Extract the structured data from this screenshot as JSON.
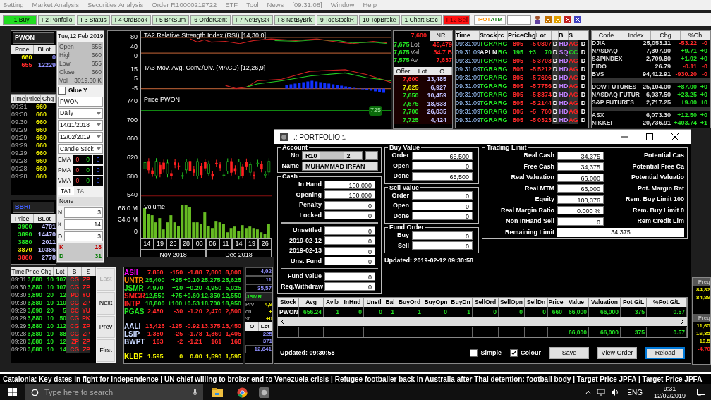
{
  "menu": [
    "Setting",
    "Market Analysis",
    "Securities Analysis",
    "Order R10000219722",
    "ETF",
    "Tool",
    "News",
    "[09:31:08]",
    "Window",
    "Help"
  ],
  "toolbar": [
    {
      "label": "F1 Buy",
      "kind": "buy"
    },
    {
      "label": "F2 Portfolio",
      "kind": "plain"
    },
    {
      "label": "F3 Status",
      "kind": "plain"
    },
    {
      "label": "F4 OrdBook",
      "kind": "plain"
    },
    {
      "label": "F5 BrkSum",
      "kind": "plain"
    },
    {
      "label": "6 OrderCent",
      "kind": "plain"
    },
    {
      "label": "F7 NetByStk",
      "kind": "plain"
    },
    {
      "label": "F8 NetByBrk",
      "kind": "plain"
    },
    {
      "label": "9 TopStockR",
      "kind": "plain"
    },
    {
      "label": "10 TopBroke",
      "kind": "plain"
    },
    {
      "label": "1 Chart Stoc",
      "kind": "plain"
    },
    {
      "label": "F12 Sell",
      "kind": "sell"
    }
  ],
  "logo": {
    "left": "IPOT",
    "right": "ATM"
  },
  "top_book": {
    "code": "PWON",
    "columns": [
      "Price",
      "BLot"
    ],
    "rows": [
      {
        "price": "660",
        "lot": "0",
        "up": false,
        "down": false
      },
      {
        "price": "655",
        "lot": "12229",
        "up": false,
        "down": true
      }
    ]
  },
  "chart_panel": {
    "date": "Tue,12 Feb 2019",
    "ohlc": [
      {
        "label": "Open",
        "value": "655"
      },
      {
        "label": "High",
        "value": "660"
      },
      {
        "label": "Low",
        "value": "655"
      },
      {
        "label": "Close",
        "value": "660"
      },
      {
        "label": "Vol",
        "value": "3019.60 K"
      }
    ],
    "glue_y": {
      "label": "Glue Y",
      "checked": false
    },
    "code": "PWON",
    "period": "Daily",
    "from": "14/11/2018",
    "to": "12/02/2019",
    "style": "Candle Stick",
    "averages": [
      {
        "label": "EMA",
        "values": [
          "0",
          "0",
          "0"
        ]
      },
      {
        "label": "PMA",
        "values": [
          "0",
          "0",
          "0"
        ]
      },
      {
        "label": "VMA",
        "values": [
          "0",
          "0",
          "0"
        ]
      }
    ],
    "tabs": [
      {
        "label": "TA1",
        "selected": true
      },
      {
        "label": "TA",
        "selected": false
      }
    ],
    "indicator": "None",
    "params": [
      {
        "label": "N",
        "value": "3"
      },
      {
        "label": "K",
        "value": "14"
      },
      {
        "label": "D",
        "value": "3"
      }
    ],
    "results": [
      {
        "label": "K",
        "value": "18",
        "up": false,
        "down": true
      },
      {
        "label": "D",
        "value": "31",
        "up": true,
        "down": false
      }
    ]
  },
  "chart": {
    "panes": [
      {
        "title": "TA2 Relative Strength Index (RSI) [14,30,0]",
        "ticks": [
          "80",
          "40",
          "0"
        ],
        "kind": "rsi"
      },
      {
        "title": "TA3 Mov. Avg. Conv./Div. (MACD) [12,26,9]",
        "ticks": [
          "15",
          "5",
          "-5"
        ],
        "kind": "macd"
      },
      {
        "title": "Price PWON",
        "ticks": [
          "740",
          "700",
          "660",
          "620",
          "580",
          "540"
        ],
        "kind": "price"
      },
      {
        "title": "Volume",
        "ticks": [
          "68.0 M",
          "34.0 M",
          "0"
        ],
        "kind": "volume"
      }
    ],
    "last_price": "725",
    "days": [
      "14",
      "19",
      "23",
      "28",
      "03",
      "06",
      "11",
      "14",
      "19",
      "26"
    ],
    "months": [
      "Nov 2018",
      "Dec 2018"
    ]
  },
  "trades_small": {
    "columns": [
      "Time",
      "Price",
      "Chg"
    ],
    "rows": [
      {
        "time": "09:31",
        "price": "660"
      },
      {
        "time": "09:30",
        "price": "660"
      },
      {
        "time": "09:30",
        "price": "660"
      },
      {
        "time": "09:29",
        "price": "660"
      },
      {
        "time": "09:29",
        "price": "660"
      },
      {
        "time": "09:29",
        "price": "660"
      },
      {
        "time": "09:29",
        "price": "660"
      },
      {
        "time": "09:28",
        "price": "660"
      },
      {
        "time": "09:28",
        "price": "660"
      },
      {
        "time": "09:28",
        "price": "660"
      }
    ]
  },
  "bbri_book": {
    "code": "BBRI",
    "columns": [
      "Price",
      "BLot"
    ],
    "rows": [
      {
        "price": "3900",
        "lot": "4781",
        "up": true,
        "down": false
      },
      {
        "price": "3890",
        "lot": "14470",
        "up": true,
        "down": false
      },
      {
        "price": "3880",
        "lot": "2011",
        "up": true,
        "down": false
      },
      {
        "price": "3870",
        "lot": "10386",
        "up": false,
        "down": false
      },
      {
        "price": "3860",
        "lot": "2778",
        "up": false,
        "down": true
      }
    ]
  },
  "trades_big": {
    "columns": [
      "Time",
      "Price",
      "Chg",
      "Lot",
      "B",
      "S"
    ],
    "rows": [
      {
        "cells": [
          "09:31",
          "3,880",
          "10",
          "107",
          "CG",
          "ZP"
        ]
      },
      {
        "cells": [
          "09:30",
          "3,880",
          "10",
          "107",
          "CG",
          "ZP"
        ]
      },
      {
        "cells": [
          "09:30",
          "3,890",
          "20",
          "12",
          "PD",
          "YU"
        ]
      },
      {
        "cells": [
          "09:30",
          "3,880",
          "10",
          "110",
          "CG",
          "ZP"
        ]
      },
      {
        "cells": [
          "09:29",
          "3,890",
          "20",
          "5",
          "CC",
          "YU"
        ]
      },
      {
        "cells": [
          "09:29",
          "3,880",
          "10",
          "50",
          "CG",
          "PK"
        ]
      },
      {
        "cells": [
          "09:29",
          "3,880",
          "10",
          "112",
          "CG",
          "ZP"
        ]
      },
      {
        "cells": [
          "09:28",
          "3,880",
          "10",
          "88",
          "CG",
          "ZP"
        ]
      },
      {
        "cells": [
          "09:28",
          "3,880",
          "10",
          "12",
          "ZP",
          "ZP"
        ]
      },
      {
        "cells": [
          "09:28",
          "3,880",
          "10",
          "14",
          "CG",
          "ZP"
        ]
      }
    ],
    "nav": [
      {
        "label": "Last",
        "disabled": true
      },
      {
        "label": "Next",
        "disabled": false
      },
      {
        "label": "Prev",
        "disabled": false
      },
      {
        "label": "First",
        "disabled": false
      }
    ]
  },
  "watchlist": [
    [
      {
        "code": "ASII",
        "color": "#ff00ff",
        "cells": [
          "7,850",
          "-150",
          "-1.88",
          "7,800",
          "8,000"
        ],
        "up": false,
        "down": true
      },
      {
        "code": "UNTR",
        "color": "#ff8a00",
        "cells": [
          "25,400",
          "+25",
          "+0.10",
          "25,275",
          "25,625"
        ],
        "up": true,
        "down": false
      },
      {
        "code": "JSMR",
        "color": "#20e020",
        "cells": [
          "4,970",
          "+10",
          "+0.20",
          "4,950",
          "5,025"
        ],
        "up": true,
        "down": false
      },
      {
        "code": "SMGR",
        "color": "#ff2020",
        "cells": [
          "12,550",
          "+75",
          "+0.60",
          "12,350",
          "12,550"
        ],
        "up": true,
        "down": false
      },
      {
        "code": "INTP",
        "color": "#ff2020",
        "cells": [
          "18,800",
          "+100",
          "+0.53",
          "18,700",
          "18,950"
        ],
        "up": true,
        "down": false
      },
      {
        "code": "PGAS",
        "color": "#20e020",
        "cells": [
          "2,480",
          "-30",
          "-1.20",
          "2,470",
          "2,500"
        ],
        "up": false,
        "down": true
      }
    ],
    [
      {
        "code": "AALI",
        "color": "#c8d8ff",
        "cells": [
          "13,425",
          "-125",
          "-0.92",
          "13,375",
          "13,450"
        ],
        "up": false,
        "down": true
      },
      {
        "code": "LSIP",
        "color": "#c8d8ff",
        "cells": [
          "1,380",
          "-25",
          "-1.78",
          "1,360",
          "1,405"
        ],
        "up": false,
        "down": true
      },
      {
        "code": "BWPT",
        "color": "#c8d8ff",
        "cells": [
          "163",
          "-2",
          "-1.21",
          "161",
          "168"
        ],
        "up": false,
        "down": true
      }
    ],
    [
      {
        "code": "KLBF",
        "color": "#ffff00",
        "cells": [
          "1,595",
          "0",
          "0.00",
          "1,590",
          "1,595"
        ],
        "up": false,
        "down": false
      }
    ]
  ],
  "jsmr_panel": {
    "values": [
      "4,02",
      "11",
      "35,57"
    ],
    "code": "JSMR",
    "stats": [
      {
        "label": "Prv",
        "value": "4,9"
      },
      {
        "label": "ch",
        "value": "+"
      },
      {
        "label": "%",
        "value": "+0"
      }
    ],
    "columns": [
      "O",
      "Lot"
    ],
    "lots": [
      "225",
      "371"
    ],
    "total": "12,841"
  },
  "mid_book": {
    "last": "7,600",
    "button": "NR",
    "stats": [
      {
        "price": "7,675",
        "label": "Lot",
        "value": "45,479"
      },
      {
        "price": "7,675",
        "label": "Val",
        "value": "34.7 B"
      },
      {
        "price": "7,575",
        "label": "Av",
        "value": "7,637"
      }
    ],
    "columns": [
      "Offer",
      "Lot",
      "O"
    ],
    "rows": [
      {
        "price": "7,600",
        "lot": "13,485",
        "up": false,
        "down": true
      },
      {
        "price": "7,625",
        "lot": "6,927",
        "up": false,
        "down": false
      },
      {
        "price": "7,650",
        "lot": "10,459",
        "up": true,
        "down": false
      },
      {
        "price": "7,675",
        "lot": "18,633",
        "up": true,
        "down": false
      },
      {
        "price": "7,700",
        "lot": "26,835",
        "up": true,
        "down": false
      },
      {
        "price": "7,725",
        "lot": "4,424",
        "up": true,
        "down": false
      }
    ]
  },
  "running_trade": {
    "columns": [
      {
        "label": "Time"
      },
      {
        "label": "Stock"
      },
      {
        "label": "rc"
      },
      {
        "label": "Price"
      },
      {
        "label": "Chg"
      },
      {
        "label": "Lot"
      },
      {},
      {
        "label": "B"
      },
      {
        "label": "S"
      },
      {}
    ],
    "rows": [
      {
        "cells": [
          "09:31:09",
          "TGRA",
          "RG",
          "805",
          "-5",
          "0807",
          "D",
          "HD",
          "AG",
          "D"
        ],
        "up": false,
        "down": true
      },
      {
        "cells": [
          "09:31:09",
          "APLN",
          "RG",
          "195",
          "+3",
          "70",
          "D",
          "SQ",
          "CC",
          "D"
        ],
        "up": true,
        "down": false
      },
      {
        "cells": [
          "09:31:09",
          "TGRA",
          "RG",
          "805",
          "-5",
          "3703",
          "D",
          "HD",
          "AG",
          "D"
        ],
        "up": false,
        "down": true
      },
      {
        "cells": [
          "09:31:09",
          "TGRA",
          "RG",
          "805",
          "-5",
          "5212",
          "D",
          "HD",
          "AG",
          "D"
        ],
        "up": false,
        "down": true
      },
      {
        "cells": [
          "09:31:09",
          "TGRA",
          "RG",
          "805",
          "-5",
          "7696",
          "D",
          "HD",
          "AG",
          "D"
        ],
        "up": false,
        "down": true
      },
      {
        "cells": [
          "09:31:09",
          "TGRA",
          "RG",
          "805",
          "-5",
          "7756",
          "D",
          "HD",
          "AG",
          "D"
        ],
        "up": false,
        "down": true
      },
      {
        "cells": [
          "09:31:09",
          "TGRA",
          "RG",
          "805",
          "-5",
          "8374",
          "D",
          "HD",
          "AG",
          "D"
        ],
        "up": false,
        "down": true
      },
      {
        "cells": [
          "09:31:09",
          "TGRA",
          "RG",
          "805",
          "-5",
          "2144",
          "D",
          "HD",
          "AG",
          "D"
        ],
        "up": false,
        "down": true
      },
      {
        "cells": [
          "09:31:09",
          "TGRA",
          "RG",
          "805",
          "-5",
          "760",
          "D",
          "HD",
          "AG",
          "D"
        ],
        "up": false,
        "down": true
      },
      {
        "cells": [
          "09:31:09",
          "TGRA",
          "RG",
          "805",
          "-5",
          "0323",
          "D",
          "HD",
          "AG",
          "D"
        ],
        "up": false,
        "down": true
      }
    ]
  },
  "indices": {
    "columns": [
      "Code",
      "Index",
      "Chg",
      "%Ch"
    ],
    "groups": [
      [
        {
          "code": "DJIA",
          "index": "25,053.11",
          "chg": "-53.22",
          "pct": "-0",
          "up": false,
          "down": true
        },
        {
          "code": "NASDAQ",
          "index": "7,307.90",
          "chg": "+9.71",
          "pct": "+0",
          "up": true,
          "down": false
        },
        {
          "code": "S&PINDEX",
          "index": "2,709.80",
          "chg": "+1.92",
          "pct": "+0",
          "up": true,
          "down": false
        },
        {
          "code": "EIDO",
          "index": "26.79",
          "chg": "-0.11",
          "pct": "-0",
          "up": false,
          "down": true
        },
        {
          "code": "BVS",
          "index": "94,412.91",
          "chg": "-930.20",
          "pct": "-0",
          "up": false,
          "down": true
        }
      ],
      [
        {
          "code": "DOW FUTURES",
          "index": "25,104.00",
          "chg": "+87.00",
          "pct": "+0",
          "up": true,
          "down": false
        },
        {
          "code": "NASDAQ FUTUR",
          "index": "6,937.50",
          "chg": "+23.25",
          "pct": "+0",
          "up": true,
          "down": false
        },
        {
          "code": "S&P FUTURES",
          "index": "2,717.25",
          "chg": "+9.00",
          "pct": "+0",
          "up": true,
          "down": false
        }
      ],
      [
        {
          "code": "ASX",
          "index": "6,073.30",
          "chg": "+12.50",
          "pct": "+0",
          "up": true,
          "down": false
        },
        {
          "code": "NIKKEI",
          "index": "20,736.91",
          "chg": "+403.74",
          "pct": "+1",
          "up": true,
          "down": false
        }
      ]
    ]
  },
  "edge_panel": {
    "header": "Freq",
    "values": [
      "84,82",
      "84,89"
    ],
    "header2": "Freq",
    "values2": [
      "11,65",
      "16,35",
      "16.5",
      "-4,70"
    ]
  },
  "portfolio": {
    "title": ".: PORTFOLIO :.",
    "account": {
      "title": "Account",
      "no_label": "No",
      "no_start": "R10",
      "no_end": "2",
      "name_label": "Name",
      "name": "MUHAMMAD IRFAN",
      "more": "..."
    },
    "cash": {
      "title": "Cash",
      "rows": [
        {
          "label": "In Hand",
          "value": "100,000"
        },
        {
          "label": "Opening",
          "value": "100,000"
        },
        {
          "label": "Penalty",
          "value": "0"
        },
        {
          "label": "Locked",
          "value": "0"
        }
      ],
      "rows2": [
        {
          "label": "Unsettled",
          "value": "0"
        },
        {
          "label": "2019-02-12",
          "value": "0"
        },
        {
          "label": "2019-02-13",
          "value": "0"
        },
        {
          "label": "Uns. Fund",
          "value": "0"
        }
      ],
      "rows3": [
        {
          "label": "Fund Value",
          "value": "0"
        },
        {
          "label": "Req.Withdraw",
          "value": "0"
        }
      ]
    },
    "buy_value": {
      "title": "Buy Value",
      "rows": [
        {
          "label": "Order",
          "value": "65,500"
        },
        {
          "label": "Open",
          "value": "0"
        },
        {
          "label": "Done",
          "value": "65,500"
        }
      ]
    },
    "sell_value": {
      "title": "Sell Value",
      "rows": [
        {
          "label": "Order",
          "value": "0"
        },
        {
          "label": "Open",
          "value": "0"
        },
        {
          "label": "Done",
          "value": "0"
        }
      ]
    },
    "fund_order": {
      "title": "Fund Order",
      "rows": [
        {
          "label": "Buy",
          "value": "0"
        },
        {
          "label": "Sell",
          "value": "0"
        }
      ]
    },
    "updated": "Updated: 2019-02-12 09:30:58",
    "trading_limit": {
      "title": "Trading Limit",
      "rows": [
        {
          "label": "Real Cash",
          "value": "34,375",
          "right": "Potential Cas"
        },
        {
          "label": "Free Cash",
          "value": "34,375",
          "right": "Potential Free Ca"
        },
        {
          "label": "Real Valuation",
          "value": "66,000",
          "right": "Potential Valuatio"
        },
        {
          "label": "Real MTM",
          "value": "66,000",
          "right": "Pot. Margin Rat"
        },
        {
          "label": "Equity",
          "value": "100,376",
          "right": "Rem. Buy Limit 100"
        },
        {
          "label": "Real Margin Ratio",
          "value": "0.000 %",
          "right": "Rem. Buy Limit 0"
        },
        {
          "label": "Non InHand Sell",
          "value": "0",
          "right": "Rem Credit Lim"
        }
      ],
      "remaining_label": "Remaining Limit",
      "remaining": "34,375"
    },
    "table": {
      "columns": [
        "Stock",
        "Avg",
        "Avlb",
        "InHnd",
        "Unstl",
        "Bal",
        "BuyOrd",
        "BuyOpn",
        "BuyDn",
        "SellOrd",
        "SellOpn",
        "SellDn",
        "Price",
        "Value",
        "Valuation",
        "Pot G/L",
        "%Pot G/L"
      ],
      "rows": [
        [
          "PWON",
          "656.24",
          "1",
          "0",
          "0",
          "1",
          "1",
          "0",
          "1",
          "0",
          "0",
          "0",
          "660",
          "66,000",
          "66,000",
          "375",
          "0.57"
        ]
      ],
      "totals": [
        {
          "value": "66,000"
        },
        {
          "value": "66,000"
        },
        {
          "value": "375"
        },
        {
          "value": "0.57"
        }
      ]
    },
    "footer": {
      "updated": "Updated: 09:30:58",
      "simple": {
        "label": "Simple",
        "checked": false
      },
      "colour": {
        "label": "Colour",
        "checked": true
      },
      "buttons": [
        {
          "label": "Save",
          "selected": false
        },
        {
          "label": "View Order",
          "selected": false
        },
        {
          "label": "Reload",
          "selected": true
        }
      ]
    }
  },
  "ticker": "Catalonia: Key dates in fight for independence  | UN chief willing to broker end to Venezuela crisis  | Refugee footballer back in Australia after Thai detention: football body  | Target Price JPFA  | Target Price JPFA",
  "taskbar": {
    "search_placeholder": "Type here to search",
    "language": "ENG",
    "time": "9:31",
    "date": "12/02/2019"
  }
}
